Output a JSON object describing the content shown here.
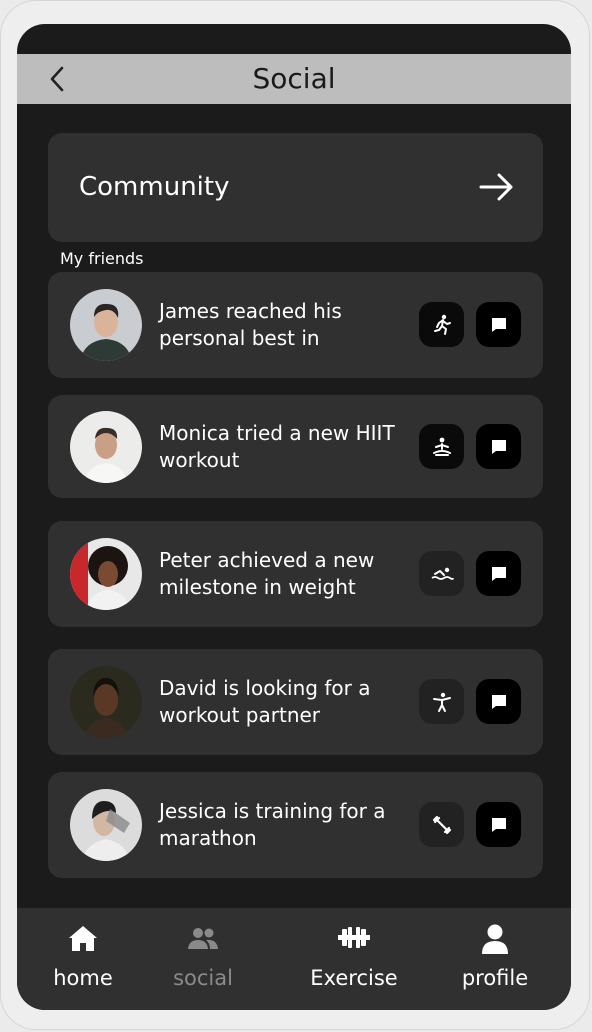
{
  "header": {
    "title": "Social",
    "back_icon": "chevron-left-icon"
  },
  "community": {
    "label": "Community",
    "icon": "arrow-right-icon"
  },
  "friends_section": {
    "label": "My friends"
  },
  "friends": [
    {
      "text": "James reached his personal best in",
      "activity_icon": "running-icon"
    },
    {
      "text": "Monica tried a new HIIT workout",
      "activity_icon": "meditation-icon"
    },
    {
      "text": "Peter achieved a new milestone in weight",
      "activity_icon": "swimming-icon"
    },
    {
      "text": "David is looking for a workout partner",
      "activity_icon": "martial-arts-icon"
    },
    {
      "text": "Jessica is training for a marathon",
      "activity_icon": "dumbbell-icon"
    }
  ],
  "nav": {
    "items": [
      {
        "label": "home",
        "icon": "home-icon",
        "active": true
      },
      {
        "label": "social",
        "icon": "people-icon",
        "active": false
      },
      {
        "label": "Exercise",
        "icon": "barbell-icon",
        "active": true
      },
      {
        "label": "profile",
        "icon": "person-icon",
        "active": true
      }
    ]
  },
  "colors": {
    "background": "#1b1b1b",
    "card": "#303030",
    "header": "#bdbdbd",
    "inactive_nav": "#8a8a8a"
  }
}
